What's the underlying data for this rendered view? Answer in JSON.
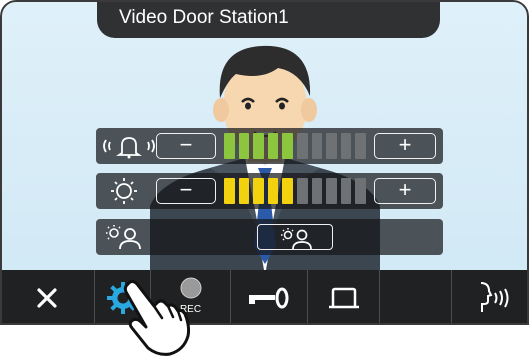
{
  "station": {
    "title": "Video Door Station1"
  },
  "controls": {
    "ring_volume": {
      "icon": "bell-volume-icon",
      "minus": "−",
      "plus": "+",
      "level": 5,
      "max": 10,
      "active_color": "#8cc63f",
      "inactive_color": "#6e7275"
    },
    "brightness": {
      "icon": "sun-icon",
      "minus": "−",
      "plus": "+",
      "level": 5,
      "max": 10,
      "active_color": "#f2d20f",
      "inactive_color": "#6e7275"
    },
    "backlight": {
      "icon": "backlight-person-icon",
      "button_icon": "backlight-person-icon"
    }
  },
  "toolbar": {
    "items": [
      {
        "name": "close",
        "icon": "close-icon"
      },
      {
        "name": "settings",
        "icon": "gear-icon",
        "active_color": "#2aa9e0"
      },
      {
        "name": "record",
        "icon": "record-icon",
        "label": "REC"
      },
      {
        "name": "door-release",
        "icon": "key-icon"
      },
      {
        "name": "option",
        "icon": "bell-shape-icon"
      },
      {
        "name": "blank",
        "icon": ""
      },
      {
        "name": "talk",
        "icon": "talk-icon"
      }
    ]
  }
}
